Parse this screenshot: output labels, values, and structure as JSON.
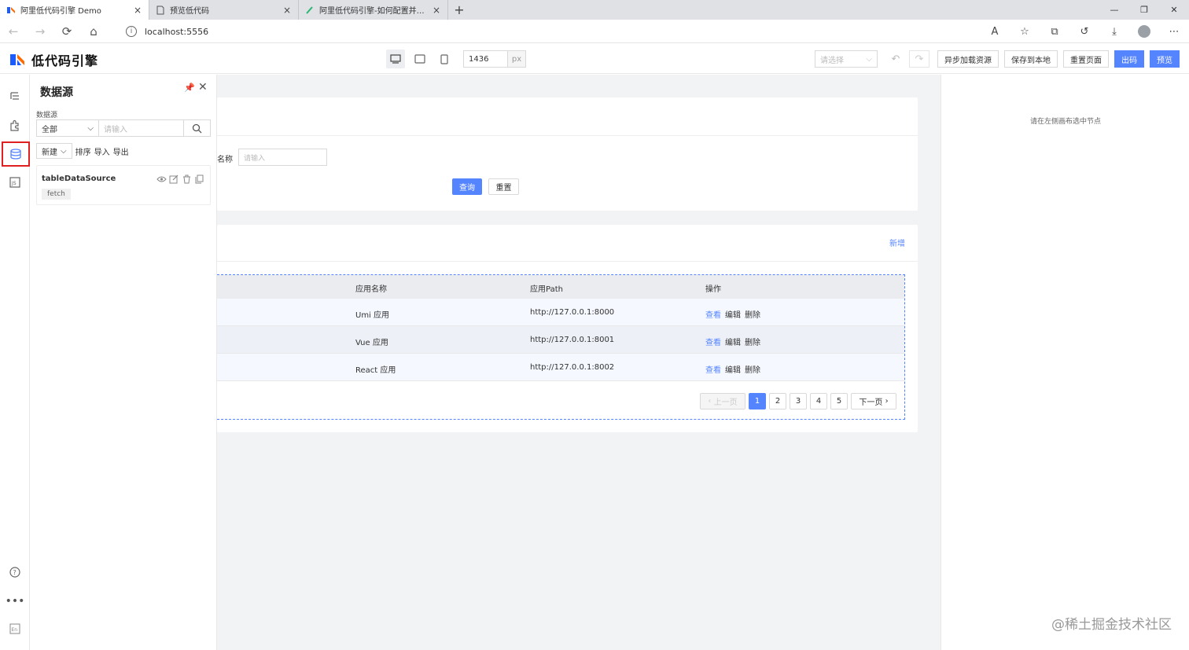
{
  "browser": {
    "tabs": [
      {
        "label": "阿里低代码引擎 Demo",
        "active": true
      },
      {
        "label": "预览低代码",
        "active": false
      },
      {
        "label": "阿里低代码引擎-如何配置并调用",
        "active": false
      }
    ],
    "url": "localhost:5556"
  },
  "toolbar": {
    "logo_text": "低代码引擎",
    "width_value": "1436",
    "width_unit": "px",
    "select_placeholder": "请选择",
    "buttons": {
      "async_load": "异步加载资源",
      "save_local": "保存到本地",
      "reset_page": "重置页面",
      "export_code": "出码",
      "preview": "预览"
    }
  },
  "datasource_panel": {
    "title": "数据源",
    "filter_label": "数据源",
    "filter_select": "全部",
    "search_placeholder": "请输入",
    "new_label": "新建",
    "sort_label": "排序",
    "import_label": "导入",
    "export_label": "导出",
    "items": [
      {
        "name": "tableDataSource",
        "type": "fetch"
      }
    ]
  },
  "canvas": {
    "form": {
      "field_label": "名称",
      "field_placeholder": "请输入",
      "query_label": "查询",
      "reset_label": "重置"
    },
    "table": {
      "add_label": "新增",
      "headers": {
        "name": "应用名称",
        "path": "应用Path",
        "ops": "操作"
      },
      "rows": [
        {
          "name": "Umi 应用",
          "path": "http://127.0.0.1:8000"
        },
        {
          "name": "Vue 应用",
          "path": "http://127.0.0.1:8001"
        },
        {
          "name": "React 应用",
          "path": "http://127.0.0.1:8002"
        }
      ],
      "ops": {
        "view": "查看",
        "edit": "编辑",
        "delete": "删除"
      },
      "pagination": {
        "prev": "上一页",
        "next": "下一页",
        "pages": [
          "1",
          "2",
          "3",
          "4",
          "5"
        ],
        "current": "1"
      }
    }
  },
  "right_panel": {
    "hint": "请在左侧画布选中节点"
  },
  "watermark": "@稀土掘金技术社区",
  "colors": {
    "accent": "#5584ff",
    "highlight": "#e02020"
  }
}
